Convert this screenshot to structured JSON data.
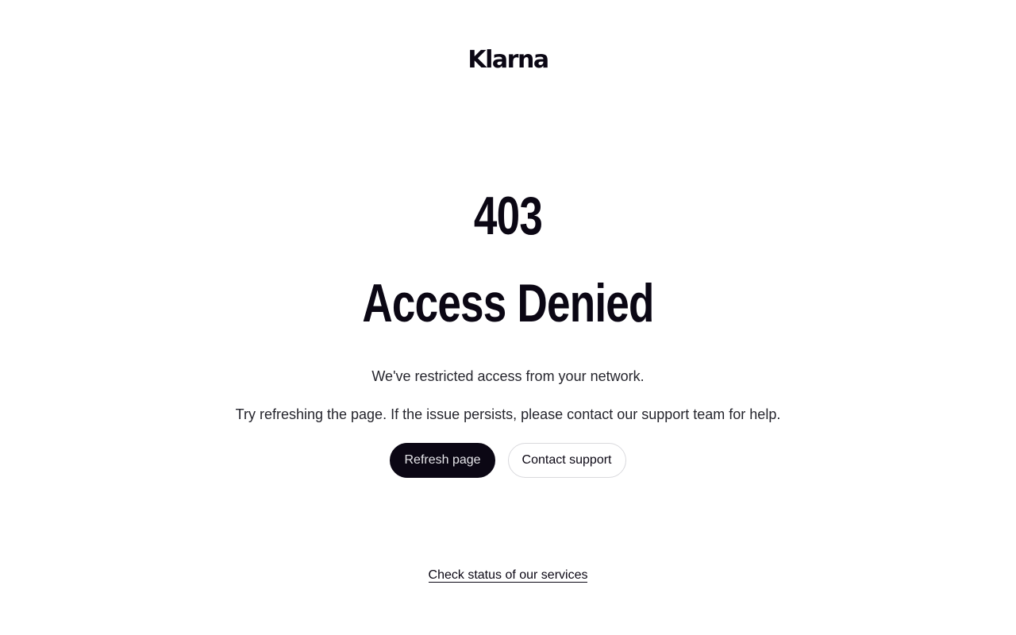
{
  "brand": {
    "logo_text": "Klarna",
    "color": "#0b0714"
  },
  "error": {
    "code": "403",
    "title": "Access Denied",
    "message_primary": "We've restricted access from your network.",
    "message_secondary": "Try refreshing the page. If the issue persists, please contact our support team for help."
  },
  "actions": {
    "refresh_label": "Refresh page",
    "contact_label": "Contact support"
  },
  "footer": {
    "status_link_label": "Check status of our services"
  }
}
